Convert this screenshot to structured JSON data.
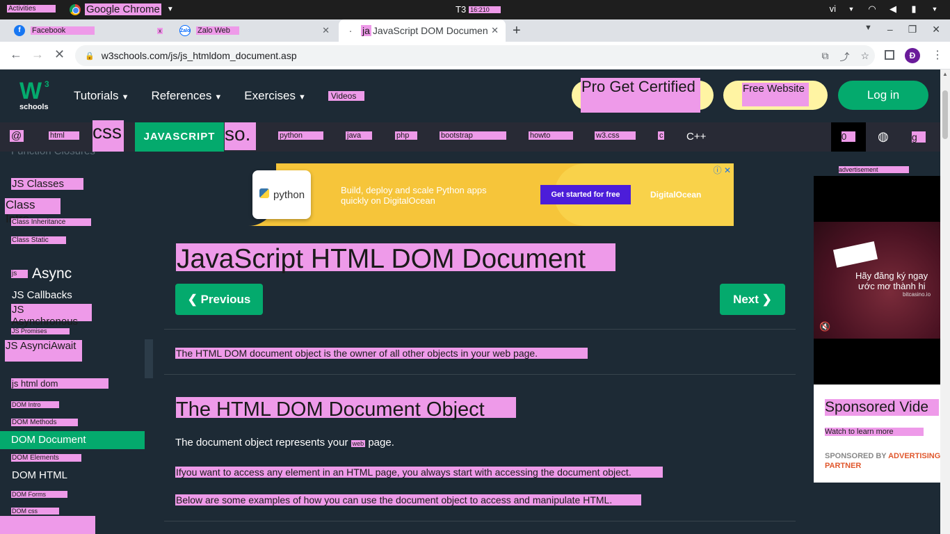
{
  "gnome": {
    "activities": "Activities",
    "app_name": "Google Chrome",
    "day": "T3",
    "time": "16:210",
    "lang": "vi"
  },
  "browser": {
    "tabs": [
      {
        "title": "Facebook",
        "close": "x"
      },
      {
        "title": "Zalo Web",
        "close": "✕"
      },
      {
        "title": "JavaScript DOM Documen",
        "prefix": "ja",
        "close": "✕"
      }
    ],
    "url": "w3schools.com/js/js_htmldom_document.asp",
    "profile_initial": "Đ"
  },
  "header": {
    "logo_sup": "3",
    "logo_main": "W",
    "logo_sub": "schools",
    "nav": [
      "Tutorials",
      "References",
      "Exercises"
    ],
    "videos": "Videos",
    "pro": "Pro Get Certified",
    "free_website": "Free Website",
    "login": "Log in"
  },
  "subnav": {
    "items": [
      "@",
      "html",
      "css",
      "JAVASCRIPT",
      "so.",
      "python",
      "java",
      "php",
      "bootstrap",
      "howto",
      "w3.css",
      "c",
      "C++"
    ],
    "right_box": "0",
    "right_g": "g"
  },
  "sidebar": {
    "cut_item": "Function Closures",
    "items": [
      {
        "label": "JS Classes"
      },
      {
        "label": "Class Intro"
      },
      {
        "label": "Class Inheritance"
      },
      {
        "label": "Class Static"
      },
      {
        "label": "js"
      },
      {
        "label": "Async"
      },
      {
        "label": "JS Callbacks"
      },
      {
        "label": "JS Asynchronous"
      },
      {
        "label": "JS Promises"
      },
      {
        "label": "JS AsynciAwait"
      },
      {
        "label": "js html dom"
      },
      {
        "label": "DOM Intro"
      },
      {
        "label": "DOM Methods"
      },
      {
        "label": "DOM Document"
      },
      {
        "label": "DOM Elements"
      },
      {
        "label": "DOM HTML"
      },
      {
        "label": "DOM Forms"
      },
      {
        "label": "DOM css"
      }
    ]
  },
  "ad": {
    "python": "python",
    "text1": "Build, deploy and scale Python apps",
    "text2": "quickly on DigitalOcean",
    "cta": "Get started for free",
    "brand": "DigitalOcean"
  },
  "main": {
    "title": "JavaScript HTML DOM Document",
    "prev": "❮ Previous",
    "next": "Next ❯",
    "intro": "The HTML DOM document object is the owner of all other objects in your web page.",
    "h2": "The HTML DOM Document Object",
    "p1_start": "The document object represents your ",
    "p1_web": "web",
    "p1_end": " page.",
    "p2": "Ifyou want to access any element in an HTML page, you always start with accessing the document object.",
    "p3": "Below are some examples of how you can use the document object to access and manipulate HTML."
  },
  "right": {
    "advertisement": "advertisement",
    "video_line1": "Hãy đăng ký ngay",
    "video_line2": "ước mơ thành hi",
    "video_domain": "bitcasino.io",
    "sponsored": "Sponsored Vide",
    "watch": "Watch to learn more",
    "by": "SPONSORED BY",
    "partner": "ADVERTISING PARTNER"
  }
}
